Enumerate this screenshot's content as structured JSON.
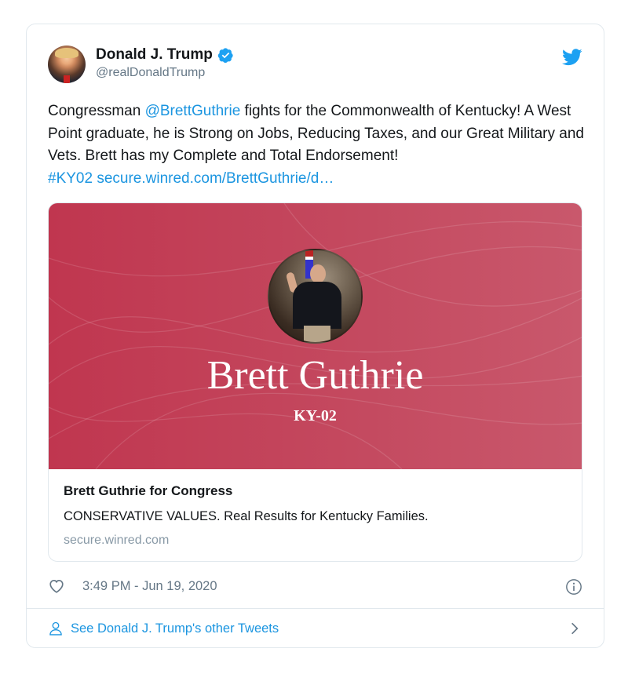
{
  "author": {
    "display_name": "Donald J. Trump",
    "handle": "@realDonaldTrump",
    "verified": true
  },
  "tweet": {
    "text_prefix": "Congressman ",
    "mention": "@BrettGuthrie",
    "text_body": " fights for the Commonwealth of Kentucky! A West Point graduate, he is Strong on Jobs, Reducing Taxes, and our Great Military and Vets. Brett has my Complete and Total Endorsement!",
    "hashtag": "#KY02",
    "url": "secure.winred.com/BrettGuthrie/d…"
  },
  "card": {
    "image_title": "Brett Guthrie",
    "image_subtitle": "KY-02",
    "title": "Brett Guthrie for Congress",
    "description": "CONSERVATIVE VALUES. Real Results for Kentucky Families.",
    "domain": "secure.winred.com"
  },
  "footer": {
    "timestamp": "3:49 PM - Jun 19, 2020",
    "more_tweets_label": "See Donald J. Trump's other Tweets"
  },
  "icons": {
    "twitter": "twitter-bird-icon",
    "verified": "verified-badge-icon",
    "like": "heart-icon",
    "info": "info-icon",
    "profile": "person-icon",
    "chevron": "chevron-right-icon"
  },
  "colors": {
    "link": "#1b95e0",
    "card_background": "#c23f57",
    "secondary_text": "#657786"
  }
}
